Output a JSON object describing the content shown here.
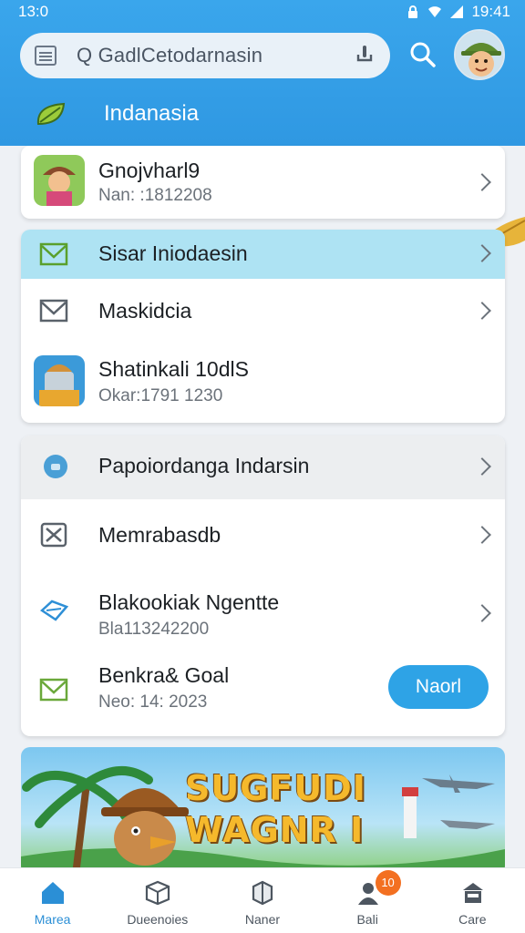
{
  "status_bar": {
    "time_left": "13:0",
    "time_right": "19:41"
  },
  "header": {
    "search_placeholder": "Q GadlCetodarnasin",
    "region_label": "Indanasia"
  },
  "card1": {
    "title": "Gnojvharl9",
    "subtitle": "Nan: :1812208"
  },
  "card2": {
    "rows": [
      {
        "title": "Sisar Iniodaesin"
      },
      {
        "title": "Maskidcia"
      },
      {
        "title": "Shatinkali 10dlS",
        "subtitle": "Okar:1791 1230"
      }
    ]
  },
  "card3": {
    "rows": [
      {
        "title": "Papoiordanga Indarsin"
      },
      {
        "title": "Memrabasdb"
      },
      {
        "title": "Blakookiak Ngentte",
        "subtitle": "Bla113242200"
      },
      {
        "title": "Benkra& Goal",
        "subtitle": "Neo: 14: 2023",
        "button": "Naorl"
      }
    ]
  },
  "banner": {
    "line1": "SUGFUDI",
    "line2": "WAGNR I"
  },
  "bottom_nav": {
    "items": [
      {
        "label": "Marea",
        "icon": "home-icon"
      },
      {
        "label": "Dueenoies",
        "icon": "box-icon"
      },
      {
        "label": "Naner",
        "icon": "cube-icon"
      },
      {
        "label": "Bali",
        "icon": "person-icon",
        "badge": "10"
      },
      {
        "label": "Care",
        "icon": "store-icon"
      }
    ]
  },
  "colors": {
    "primary": "#2f98e2",
    "highlight": "#aee3f3",
    "badge": "#f37021"
  }
}
